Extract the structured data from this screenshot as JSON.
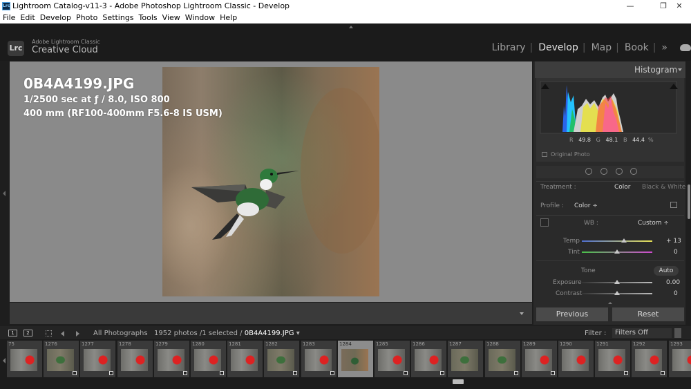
{
  "window": {
    "title": "Lightroom Catalog-v11-3 - Adobe Photoshop Lightroom Classic - Develop",
    "app_icon_text": "Lrc",
    "controls": [
      "—",
      "❐",
      "✕"
    ]
  },
  "menu": [
    "File",
    "Edit",
    "Develop",
    "Photo",
    "Settings",
    "Tools",
    "View",
    "Window",
    "Help"
  ],
  "identity": {
    "logo": "Lrc",
    "line1": "Adobe Lightroom Classic",
    "line2": "Creative Cloud"
  },
  "modules": [
    "Library",
    "Develop",
    "Map",
    "Book"
  ],
  "active_module": "Develop",
  "modules_more": "»",
  "photo_info": {
    "filename": "0B4A4199.JPG",
    "exposure": "1/2500 sec at ƒ / 8.0, ISO 800",
    "lens": "400 mm (RF100-400mm F5.6-8 IS USM)"
  },
  "right_panel": {
    "histogram_title": "Histogram",
    "rgb": {
      "r_label": "R",
      "r": "49.8",
      "g_label": "G",
      "g": "48.1",
      "b_label": "B",
      "b": "44.4",
      "unit": "%"
    },
    "original_photo": "Original Photo",
    "treatment_label": "Treatment :",
    "treatment_color": "Color",
    "treatment_bw": "Black & White",
    "profile_label": "Profile :",
    "profile_value": "Color ÷",
    "wb_label": "WB :",
    "wb_value": "Custom ÷",
    "temp_label": "Temp",
    "temp_value": "+ 13",
    "tint_label": "Tint",
    "tint_value": "0",
    "tone_label": "Tone",
    "auto_label": "Auto",
    "exposure_label": "Exposure",
    "exposure_value": "0.00",
    "contrast_label": "Contrast",
    "contrast_value": "0",
    "previous_label": "Previous",
    "reset_label": "Reset",
    "sliders": {
      "temp": 0.6,
      "tint": 0.5,
      "exposure": 0.5,
      "contrast": 0.5
    }
  },
  "filmstrip_bar": {
    "monitor1": "1",
    "monitor2": "2",
    "source": "All Photographs",
    "count_text": "1952 photos /1 selected /",
    "current_file": "0B4A4199.JPG",
    "dropdown": "▾",
    "filter_label": "Filter :",
    "filter_value": "Filters Off"
  },
  "filmstrip": [
    {
      "num": "75",
      "kind": "feeder"
    },
    {
      "num": "1276",
      "kind": "bird"
    },
    {
      "num": "1277",
      "kind": "feeder"
    },
    {
      "num": "1278",
      "kind": "feeder"
    },
    {
      "num": "1279",
      "kind": "feeder"
    },
    {
      "num": "1280",
      "kind": "feeder"
    },
    {
      "num": "1281",
      "kind": "feeder"
    },
    {
      "num": "1282",
      "kind": "bird"
    },
    {
      "num": "1283",
      "kind": "feeder"
    },
    {
      "num": "1284",
      "kind": "selected"
    },
    {
      "num": "1285",
      "kind": "feeder"
    },
    {
      "num": "1286",
      "kind": "feeder"
    },
    {
      "num": "1287",
      "kind": "bird"
    },
    {
      "num": "1288",
      "kind": "bird"
    },
    {
      "num": "1289",
      "kind": "feeder"
    },
    {
      "num": "1290",
      "kind": "feeder"
    },
    {
      "num": "1291",
      "kind": "feeder"
    },
    {
      "num": "1292",
      "kind": "feeder"
    },
    {
      "num": "1293",
      "kind": "feeder"
    }
  ]
}
